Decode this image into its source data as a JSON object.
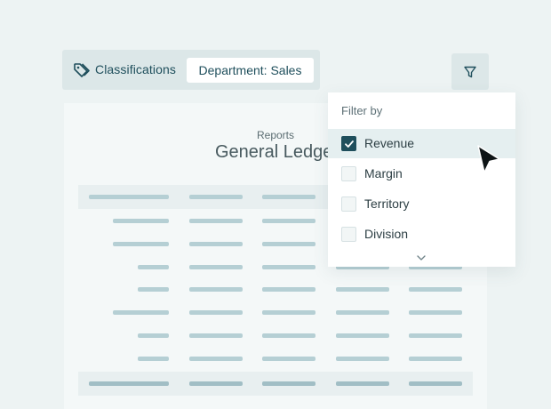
{
  "toolbar": {
    "classifications_label": "Classifications",
    "department_chip": "Department: Sales",
    "filter_icon": "filter-icon"
  },
  "report": {
    "subtitle": "Reports",
    "title": "General Ledger"
  },
  "filter_menu": {
    "header": "Filter by",
    "options": [
      {
        "label": "Revenue",
        "checked": true
      },
      {
        "label": "Margin",
        "checked": false
      },
      {
        "label": "Territory",
        "checked": false
      },
      {
        "label": "Division",
        "checked": false
      }
    ],
    "more_icon": "chevron-down-icon"
  },
  "colors": {
    "background": "#edf3f3",
    "accent": "#1f4f5c",
    "chip_bg": "#dce7e8",
    "placeholder_bar": "#b5cfd4"
  }
}
